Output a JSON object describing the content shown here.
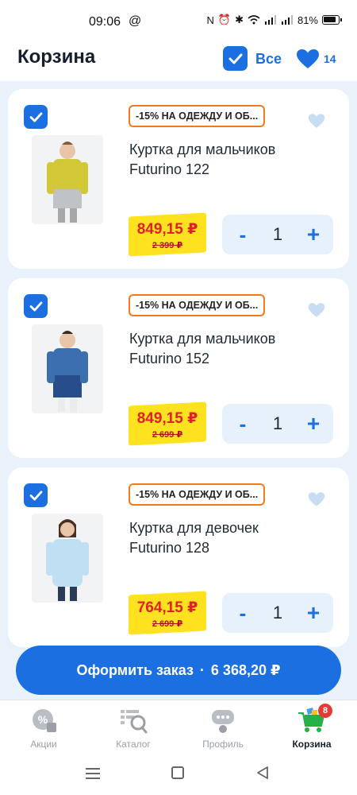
{
  "status_bar": {
    "time": "09:06",
    "at": "@",
    "battery": "81%"
  },
  "header": {
    "title": "Корзина",
    "select_all_label": "Все",
    "favorites_count": "14"
  },
  "cart": {
    "items": [
      {
        "promo": "-15% НА ОДЕЖДУ И ОБ...",
        "name": "Куртка для мальчиков Futurino 122",
        "price": "849,15 ₽",
        "old_price": "2 399 ₽",
        "qty": "1",
        "minus": "-",
        "plus": "+",
        "jacket_color": "#d2c837",
        "jacket_bottom": "#bfc3c6"
      },
      {
        "promo": "-15% НА ОДЕЖДУ И ОБ...",
        "name": "Куртка для мальчиков Futurino 152",
        "price": "849,15 ₽",
        "old_price": "2 699 ₽",
        "qty": "1",
        "minus": "-",
        "plus": "+",
        "jacket_color": "#3c6fb0",
        "jacket_bottom": "#274e8a"
      },
      {
        "promo": "-15% НА ОДЕЖДУ И ОБ...",
        "name": "Куртка для девочек Futurino 128",
        "price": "764,15 ₽",
        "old_price": "2 699 ₽",
        "qty": "1",
        "minus": "-",
        "plus": "+",
        "jacket_color": "#bfe0f2",
        "jacket_bottom": "#aed3ea"
      }
    ]
  },
  "checkout": {
    "label": "Оформить заказ",
    "separator": "·",
    "total": "6 368,20 ₽"
  },
  "tabs": [
    {
      "label": "Акции",
      "icon": "percent-icon"
    },
    {
      "label": "Каталог",
      "icon": "catalog-search-icon"
    },
    {
      "label": "Профиль",
      "icon": "profile-icon"
    },
    {
      "label": "Корзина",
      "icon": "cart-icon",
      "badge": "8"
    }
  ],
  "colors": {
    "accent": "#1b6fe0",
    "price_red": "#e0202a",
    "price_tag_yellow": "#ffe21f",
    "promo_border": "#f07b1a"
  }
}
